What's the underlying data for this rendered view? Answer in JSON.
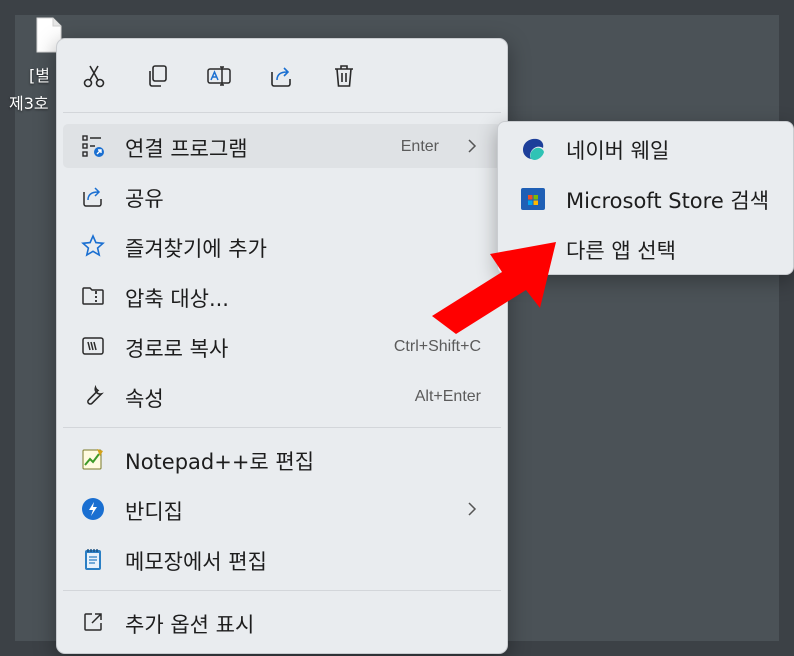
{
  "desktop": {
    "file_label_line1": "[별",
    "file_label_line2": "제3호"
  },
  "quick_actions": [
    {
      "name": "cut",
      "icon": "scissors-icon"
    },
    {
      "name": "copy",
      "icon": "copy-icon"
    },
    {
      "name": "rename",
      "icon": "rename-icon"
    },
    {
      "name": "share",
      "icon": "share-icon"
    },
    {
      "name": "delete",
      "icon": "trash-icon"
    }
  ],
  "menu": {
    "open_with": {
      "label": "연결 프로그램",
      "shortcut": "Enter"
    },
    "share": {
      "label": "공유"
    },
    "favorites": {
      "label": "즐겨찾기에 추가"
    },
    "compress": {
      "label": "압축 대상..."
    },
    "copy_path": {
      "label": "경로로 복사",
      "shortcut": "Ctrl+Shift+C"
    },
    "properties": {
      "label": "속성",
      "shortcut": "Alt+Enter"
    },
    "notepadpp": {
      "label": "Notepad++로 편집"
    },
    "bandizip": {
      "label": "반디집"
    },
    "notepad": {
      "label": "메모장에서 편집"
    },
    "more_options": {
      "label": "추가 옵션 표시"
    }
  },
  "submenu": {
    "whale": {
      "label": "네이버 웨일"
    },
    "store": {
      "label": "Microsoft Store 검색"
    },
    "choose_app": {
      "label": "다른 앱 선택"
    }
  },
  "colors": {
    "menu_bg": "#e9ecef",
    "highlight": "#dfe2e5",
    "icon_blue": "#1a6fd1",
    "arrow_red": "#ff0000"
  }
}
